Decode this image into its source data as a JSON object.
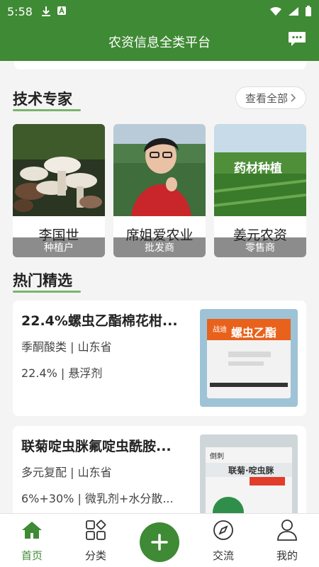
{
  "status": {
    "time": "5:58"
  },
  "header": {
    "title": "农资信息全类平台"
  },
  "experts_section": {
    "title": "技术专家",
    "more": "查看全部"
  },
  "experts": [
    {
      "tag": "种植户",
      "name": "李国世"
    },
    {
      "tag": "批发商",
      "name": "席姐爱农业"
    },
    {
      "tag": "零售商",
      "name": "姜元农资",
      "image_text": "药材种植"
    }
  ],
  "hot_section": {
    "title": "热门精选"
  },
  "products": [
    {
      "title": "22.4%螺虫乙酯棉花柑...",
      "line1": "季酮酸类 | 山东省",
      "line2": "22.4% | 悬浮剂",
      "pack_brand": "战迪",
      "pack_name": "螺虫乙酯"
    },
    {
      "title": "联菊啶虫脒氟啶虫酰胺...",
      "line1": "多元复配 | 山东省",
      "line2": "6%+30% | 微乳剂+水分散...",
      "pack_brand": "倒刺",
      "pack_name": "联菊·啶虫脒"
    }
  ],
  "tabs": [
    {
      "label": "首页",
      "icon": "home-icon",
      "active": true
    },
    {
      "label": "分类",
      "icon": "category-icon"
    },
    {
      "label": "",
      "icon": "plus-icon"
    },
    {
      "label": "交流",
      "icon": "compass-icon"
    },
    {
      "label": "我的",
      "icon": "user-icon"
    }
  ],
  "colors": {
    "brand": "#3f8a34",
    "accent_underline": "#5aa54a"
  }
}
